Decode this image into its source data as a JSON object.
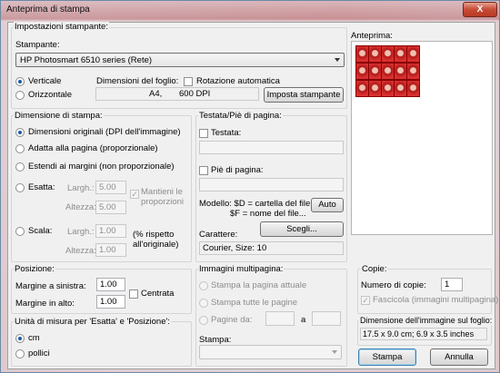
{
  "window": {
    "title": "Anteprima di stampa",
    "close_label": "X"
  },
  "printer_settings": {
    "group_label": "Impostazioni stampante:",
    "printer_label": "Stampante:",
    "printer_value": "HP Photosmart 6510 series (Rete)",
    "orientation_portrait": "Verticale",
    "orientation_landscape": "Orizzontale",
    "orientation_selected": "Verticale",
    "paper_dimensions_label": "Dimensioni del foglio:",
    "auto_rotate_label": "Rotazione automatica",
    "auto_rotate_checked": false,
    "paper_size": "A4,",
    "dpi": "600 DPI",
    "printer_setup_button": "Imposta stampante"
  },
  "preview": {
    "label": "Anteprima:",
    "thumbnail_rows": 3,
    "thumbnail_cols": 5
  },
  "print_size": {
    "group_label": "Dimensione di stampa:",
    "opt_original": "Dimensioni originali (DPI dell'immagine)",
    "opt_fit": "Adatta alla pagina (proporzionale)",
    "opt_stretch": "Estendi ai margini (non proporzionale)",
    "opt_exact": "Esatta:",
    "opt_scale": "Scala:",
    "selected": "Dimensioni originali (DPI dell'immagine)",
    "width_label": "Largh.:",
    "height_label": "Altezza:",
    "exact_width": "5.00",
    "exact_height": "5.00",
    "keep_ratio_label_1": "Mantieni le",
    "keep_ratio_label_2": "proporzioni",
    "scale_width": "1.00",
    "scale_height": "1.00",
    "scale_note_1": "(% rispetto",
    "scale_note_2": "all'originale)"
  },
  "header_footer": {
    "group_label": "Testata/Piè di pagina:",
    "header_label": "Testata:",
    "footer_label": "Piè di pagina:",
    "model_label_1": "Modello: $D = cartella del file",
    "model_label_2": "$F = nome del file...",
    "auto_button": "Auto",
    "font_label": "Carattere:",
    "choose_button": "Scegli...",
    "font_value": "Courier, Size: 10"
  },
  "position": {
    "group_label": "Posizione:",
    "left_margin_label": "Margine a sinistra:",
    "left_margin_value": "1.00",
    "top_margin_label": "Margine in alto:",
    "top_margin_value": "1.00",
    "center_label": "Centrata"
  },
  "units": {
    "group_label": "Unità di misura per 'Esatta' e 'Posizione':",
    "cm": "cm",
    "inches": "pollici",
    "selected": "cm"
  },
  "multipage": {
    "group_label": "Immagini multipagina:",
    "opt_current": "Stampa la pagina attuale",
    "opt_all": "Stampa tutte le pagine",
    "opt_pages": "Pagine da:",
    "to_label": "a",
    "print_label": "Stampa:"
  },
  "copies": {
    "group_label": "Copie:",
    "count_label": "Numero di copie:",
    "count_value": "1",
    "collate_label": "Fascicola (immagini multipagina)",
    "collate_checked": true
  },
  "image_size": {
    "label": "Dimensione dell'immagine sul foglio:",
    "value": "17.5 x 9.0 cm; 6.9 x 3.5 inches"
  },
  "actions": {
    "print_button": "Stampa",
    "cancel_button": "Annulla"
  }
}
